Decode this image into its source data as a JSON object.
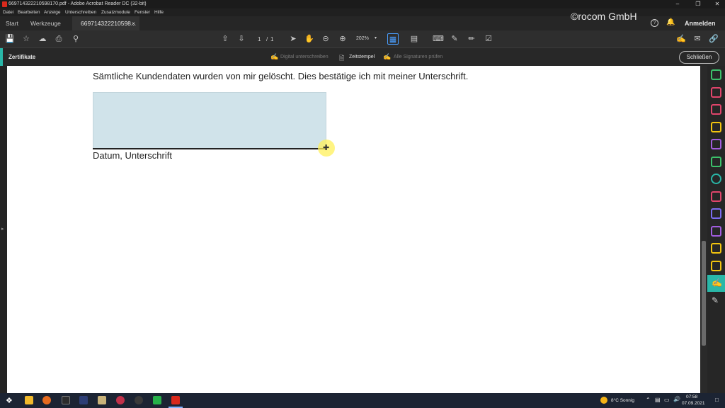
{
  "window": {
    "title": "669714322210598170.pdf - Adobe Acrobat Reader DC (32-bit)",
    "controls": [
      "–",
      "❐",
      "✕"
    ]
  },
  "watermark": "©rocom GmbH",
  "menu": [
    "Datei",
    "Bearbeiten",
    "Anzeige",
    "Unterschreiben",
    "Zusatzmodule",
    "Fenster",
    "Hilfe"
  ],
  "tabs": {
    "start": "Start",
    "tools": "Werkzeuge",
    "doc": "669714322210598...",
    "doc_close": "×"
  },
  "header_right": {
    "help": "?",
    "signin": "Anmelden"
  },
  "toolbar": {
    "page_current": "1",
    "page_sep": "/",
    "page_total": "1",
    "zoom": "202%"
  },
  "certbar": {
    "title": "Zertifikate",
    "sign_digital": "Digital unterschreiben",
    "timestamp": "Zeitstempel",
    "validate_all": "Alle Signaturen prüfen",
    "close": "Schließen"
  },
  "document": {
    "statement": "Sämtliche Kundendaten wurden von mir gelöscht. Dies bestätige ich mit meiner Unterschrift.",
    "signature_label": "Datum, Unterschrift"
  },
  "taskbar": {
    "weather": "8°C  Sonnig",
    "time": "07:58",
    "date": "07.09.2021"
  },
  "colors": {
    "accent": "#29b7a8",
    "signature_field": "#d0e3ea",
    "pdf_red": "#d9291c"
  }
}
